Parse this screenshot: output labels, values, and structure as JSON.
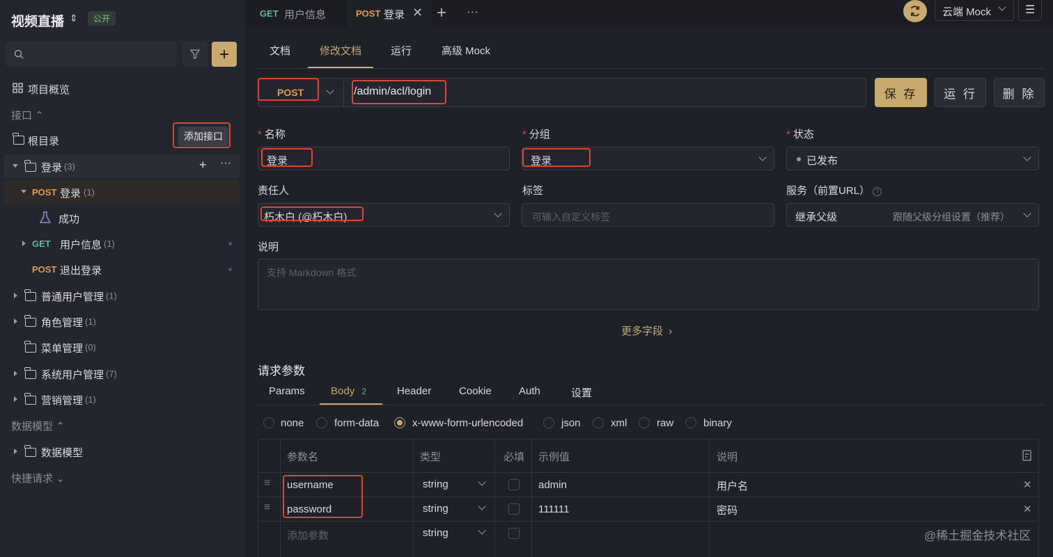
{
  "project": {
    "title": "视频直播",
    "badge": "公开"
  },
  "sidebar": {
    "overview": "项目概览",
    "interfaces_section": "接口",
    "tooltip": "添加接口",
    "root": "根目录",
    "tree": {
      "login_folder": {
        "label": "登录",
        "count": "(3)"
      },
      "post_login": {
        "method": "POST",
        "label": "登录",
        "count": "(1)"
      },
      "success": "成功",
      "get_userinfo": {
        "method": "GET",
        "label": "用户信息",
        "count": "(1)"
      },
      "post_logout": {
        "method": "POST",
        "label": "退出登录"
      },
      "folders": [
        {
          "label": "普通用户管理",
          "count": "(1)"
        },
        {
          "label": "角色管理",
          "count": "(1)"
        },
        {
          "label": "菜单管理",
          "count": "(0)"
        },
        {
          "label": "系统用户管理",
          "count": "(7)"
        },
        {
          "label": "营销管理",
          "count": "(1)"
        }
      ]
    },
    "models_section": "数据模型",
    "models_folder": "数据模型",
    "quick_section": "快捷请求"
  },
  "tabs": [
    {
      "method": "GET",
      "label": "用户信息"
    },
    {
      "method": "POST",
      "label": "登录"
    }
  ],
  "env": {
    "label": "云端 Mock"
  },
  "subtabs": [
    "文档",
    "修改文档",
    "运行",
    "高级 Mock"
  ],
  "request": {
    "method": "POST",
    "url": "/admin/acl/login",
    "save": "保 存",
    "run": "运 行",
    "delete": "删 除"
  },
  "form": {
    "name_label": "名称",
    "name_value": "登录",
    "group_label": "分组",
    "group_value": "登录",
    "status_label": "状态",
    "status_value": "已发布",
    "owner_label": "责任人",
    "owner_value": "朽木白 (@朽木白)",
    "tags_label": "标签",
    "tags_placeholder": "可输入自定义标签",
    "service_label": "服务（前置URL）",
    "service_value": "继承父级",
    "service_hint": "跟随父级分组设置（推荐）",
    "desc_label": "说明",
    "desc_placeholder": "支持 Markdown 格式",
    "more_fields": "更多字段"
  },
  "params": {
    "title": "请求参数",
    "tabs": [
      {
        "label": "Params"
      },
      {
        "label": "Body",
        "badge": "2"
      },
      {
        "label": "Header"
      },
      {
        "label": "Cookie"
      },
      {
        "label": "Auth"
      },
      {
        "label": "设置"
      }
    ],
    "body_types": [
      "none",
      "form-data",
      "x-www-form-urlencoded",
      "json",
      "xml",
      "raw",
      "binary"
    ],
    "selected_body_type": "x-www-form-urlencoded",
    "columns": [
      "参数名",
      "类型",
      "必填",
      "示例值",
      "说明"
    ],
    "rows": [
      {
        "name": "username",
        "type": "string",
        "example": "admin",
        "desc": "用户名"
      },
      {
        "name": "password",
        "type": "string",
        "example": "111111",
        "desc": "密码"
      }
    ],
    "add_placeholder": "添加参数",
    "add_type": "string"
  },
  "watermark": "@稀土掘金技术社区",
  "colors": {
    "accent": "#c9a96e",
    "post": "#e49a52",
    "get": "#5fb79a",
    "highlight": "#e2452f"
  }
}
